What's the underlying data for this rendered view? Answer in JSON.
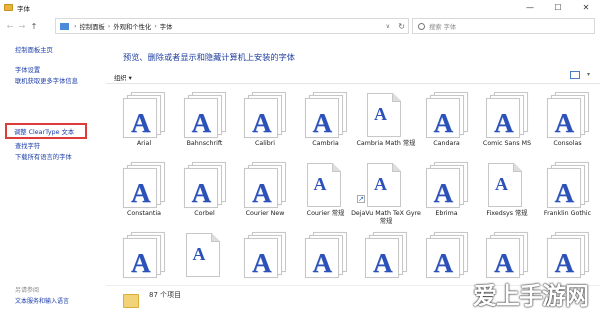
{
  "window": {
    "title": "字体",
    "controls": [
      "—",
      "☐",
      "✕"
    ]
  },
  "nav": {
    "back": "←",
    "forward": "→",
    "up": "↑"
  },
  "address": {
    "breadcrumbs": [
      "控制面板",
      "外观和个性化",
      "字体"
    ],
    "dropdown": "∨",
    "refresh": "↻"
  },
  "search": {
    "placeholder": "搜索 字体"
  },
  "sidebar": {
    "links": [
      {
        "label": "控制面板主页"
      },
      {
        "label": "字体设置"
      },
      {
        "label": "联机获取更多字体信息"
      },
      {
        "label": "调整 ClearType 文本"
      },
      {
        "label": "查找字符"
      },
      {
        "label": "下载所有语言的字体"
      }
    ],
    "see_also": "另请参阅",
    "footer_link": "文本服务和输入语言"
  },
  "main": {
    "heading": "预览、删除或者显示和隐藏计算机上安装的字体",
    "organize": "组织 ▾",
    "view_dd": "▾"
  },
  "fonts": [
    {
      "name": "Arial",
      "style": "stack"
    },
    {
      "name": "Bahnschrift",
      "style": "stack"
    },
    {
      "name": "Calibri",
      "style": "stack"
    },
    {
      "name": "Cambria",
      "style": "stack"
    },
    {
      "name": "Cambria Math 常规",
      "style": "doc"
    },
    {
      "name": "Candara",
      "style": "stack"
    },
    {
      "name": "Comic Sans MS",
      "style": "stack"
    },
    {
      "name": "Consolas",
      "style": "stack"
    },
    {
      "name": "Constantia",
      "style": "stack"
    },
    {
      "name": "Corbel",
      "style": "stack"
    },
    {
      "name": "Courier New",
      "style": "stack"
    },
    {
      "name": "Courier 常规",
      "style": "doc"
    },
    {
      "name": "DejaVu Math TeX Gyre 常规",
      "style": "doc-shortcut"
    },
    {
      "name": "Ebrima",
      "style": "stack"
    },
    {
      "name": "Fixedsys 常规",
      "style": "doc"
    },
    {
      "name": "Franklin Gothic",
      "style": "stack"
    },
    {
      "name": "",
      "style": "stack"
    },
    {
      "name": "",
      "style": "doc"
    },
    {
      "name": "",
      "style": "stack"
    },
    {
      "name": "",
      "style": "stack"
    },
    {
      "name": "",
      "style": "stack"
    },
    {
      "name": "",
      "style": "stack"
    },
    {
      "name": "",
      "style": "stack"
    },
    {
      "name": "",
      "style": "stack"
    }
  ],
  "glyph": "A",
  "status": {
    "count": "87 个项目"
  },
  "watermark": "爱上手游网",
  "colors": {
    "link": "#1a3ca8",
    "heading": "#1e3ea0",
    "glyph": "#2c52b9",
    "highlight": "#e03b3b"
  }
}
